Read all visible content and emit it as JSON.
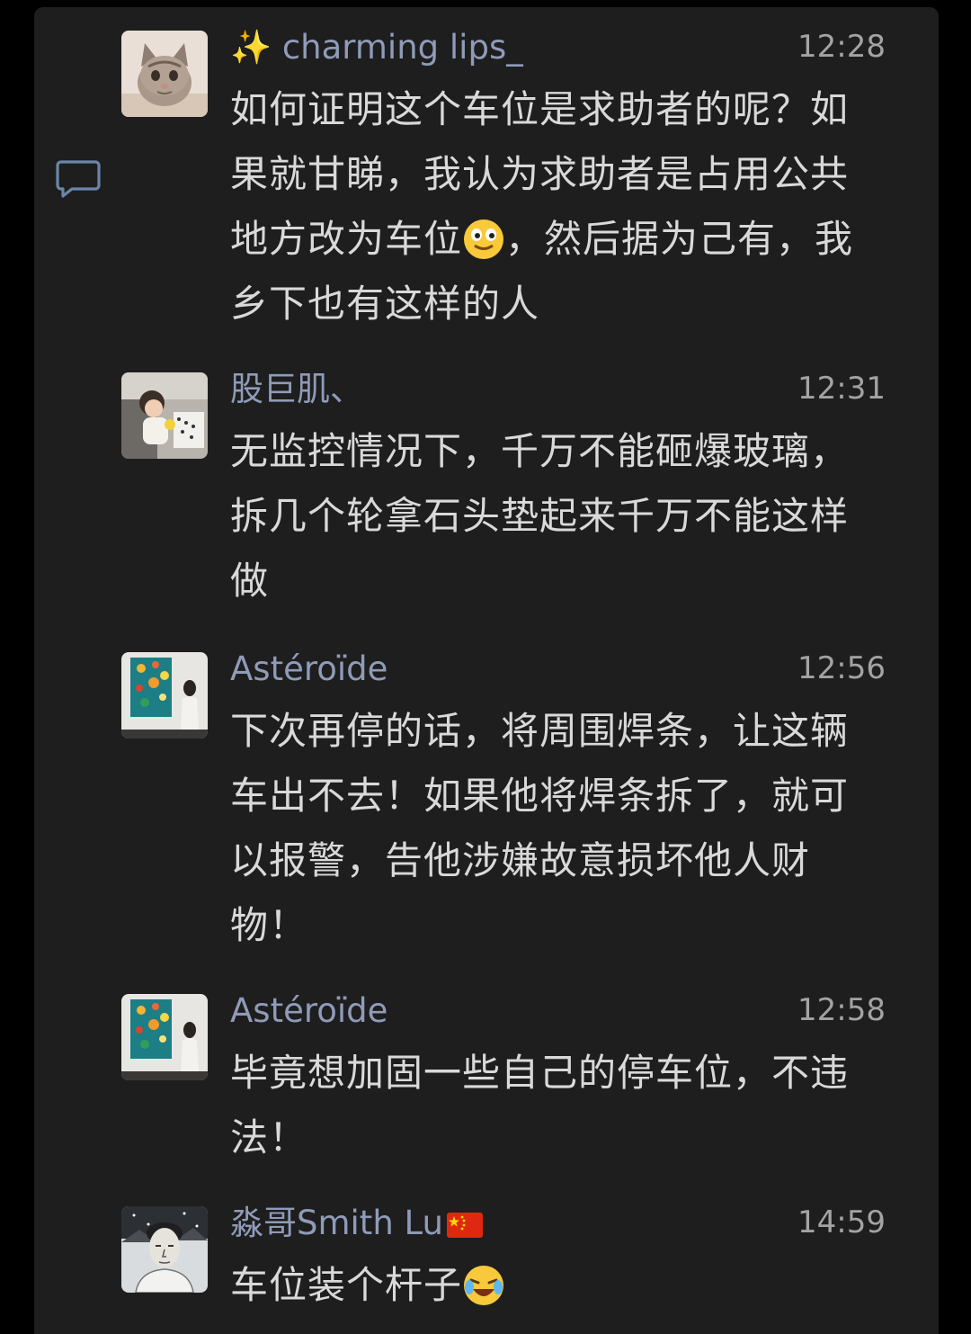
{
  "comments": [
    {
      "name": "charming lips_",
      "name_prefix_icon": "sparkles-emoji",
      "time": "12:28",
      "text_a": "如何证明这个车位是求助者的呢？如果就甘睇，我认为求助者是占用公共地方改为车位",
      "inline_emoji": "smile-emoji",
      "text_b": "，然后据为己有，我乡下也有这样的人",
      "avatar": "cat-avatar"
    },
    {
      "name": "股巨肌、",
      "time": "12:31",
      "text": "无监控情况下，千万不能砸爆玻璃，拆几个轮拿石头垫起来千万不能这样做",
      "avatar": "child-photo-avatar"
    },
    {
      "name": "Astéroïde",
      "time": "12:56",
      "text": "下次再停的话，将周围焊条，让这辆车出不去！如果他将焊条拆了，就可以报警，告他涉嫌故意损坏他人财物！",
      "avatar": "painting-photo-avatar"
    },
    {
      "name": "Astéroïde",
      "time": "12:58",
      "text": "毕竟想加固一些自己的停车位，不违法！",
      "avatar": "painting-photo-avatar"
    },
    {
      "name": "淼哥Smith Lu",
      "name_suffix_icon": "china-flag-emoji",
      "time": "14:59",
      "text": "车位装个杆子",
      "inline_emoji": "laughing-crying-emoji",
      "avatar": "sketch-portrait-avatar"
    }
  ],
  "side_icon": "comment-bubble-icon",
  "colors": {
    "background": "#000000",
    "panel": "#1e1e1e",
    "name": "#8f9bb8",
    "time": "#a3a3a3",
    "text": "#d9d9d9"
  }
}
